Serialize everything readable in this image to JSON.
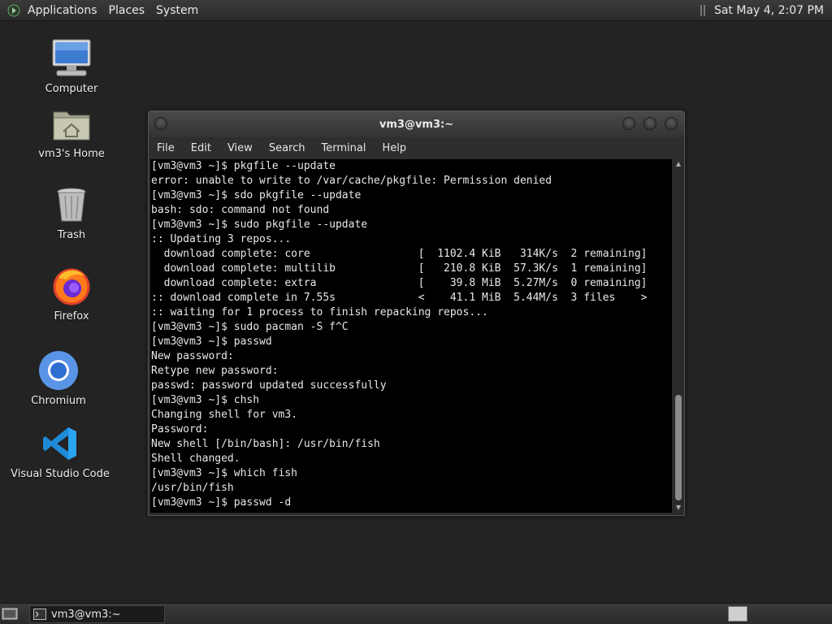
{
  "top_panel": {
    "menus": [
      "Applications",
      "Places",
      "System"
    ],
    "clock": "Sat May  4,  2:07 PM"
  },
  "desktop_icons": [
    {
      "label": "Computer"
    },
    {
      "label": "vm3's Home"
    },
    {
      "label": "Trash"
    },
    {
      "label": "Firefox"
    },
    {
      "label": "Chromium"
    },
    {
      "label": "Visual Studio Code"
    }
  ],
  "terminal": {
    "title": "vm3@vm3:~",
    "menu": [
      "File",
      "Edit",
      "View",
      "Search",
      "Terminal",
      "Help"
    ],
    "lines": [
      "[vm3@vm3 ~]$ pkgfile --update",
      "error: unable to write to /var/cache/pkgfile: Permission denied",
      "[vm3@vm3 ~]$ sdo pkgfile --update",
      "bash: sdo: command not found",
      "[vm3@vm3 ~]$ sudo pkgfile --update",
      ":: Updating 3 repos...",
      "  download complete: core                 [  1102.4 KiB   314K/s  2 remaining]",
      "  download complete: multilib             [   210.8 KiB  57.3K/s  1 remaining]",
      "  download complete: extra                [    39.8 MiB  5.27M/s  0 remaining]",
      ":: download complete in 7.55s             <    41.1 MiB  5.44M/s  3 files    >",
      ":: waiting for 1 process to finish repacking repos...",
      "[vm3@vm3 ~]$ sudo pacman -S f^C",
      "[vm3@vm3 ~]$ passwd",
      "New password:",
      "Retype new password:",
      "passwd: password updated successfully",
      "[vm3@vm3 ~]$ chsh",
      "Changing shell for vm3.",
      "Password:",
      "New shell [/bin/bash]: /usr/bin/fish",
      "Shell changed.",
      "[vm3@vm3 ~]$ which fish",
      "/usr/bin/fish",
      "[vm3@vm3 ~]$ passwd -d"
    ]
  },
  "taskbar": {
    "window_button": "vm3@vm3:~"
  }
}
